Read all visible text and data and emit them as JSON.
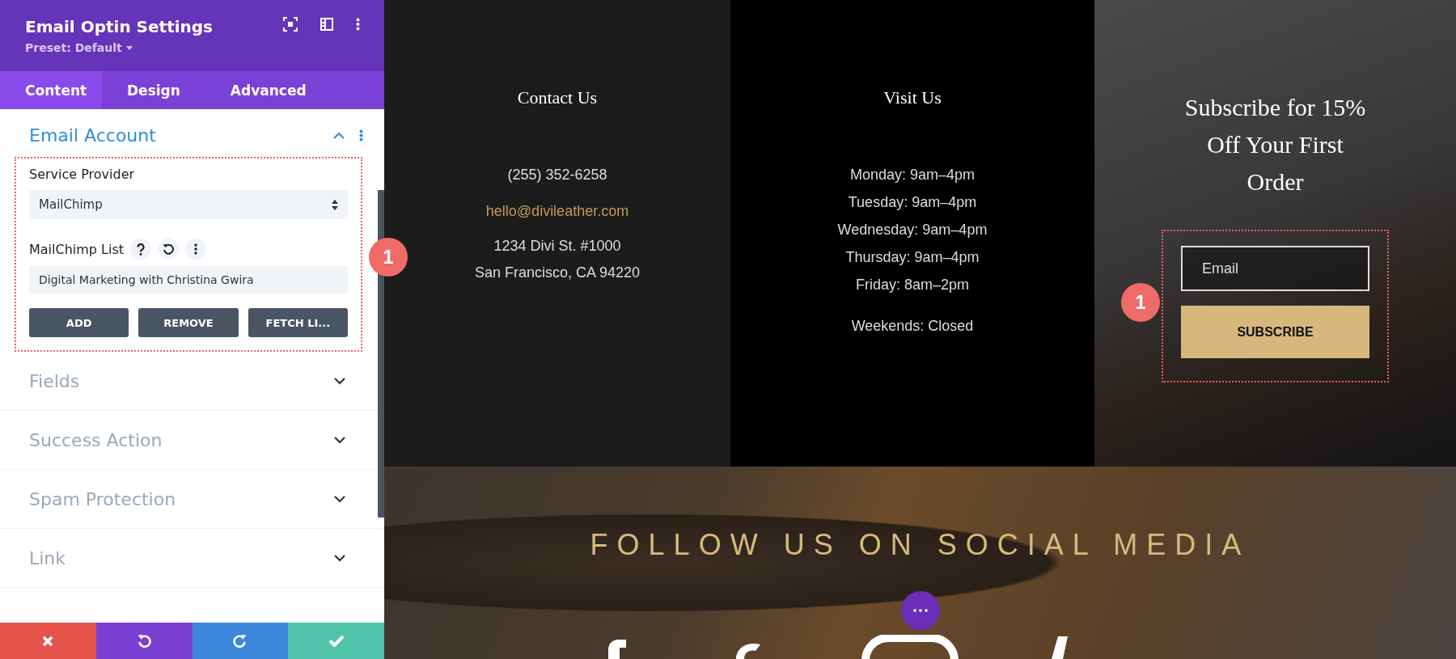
{
  "panel": {
    "title": "Email Optin Settings",
    "preset": "Preset: Default",
    "tabs": [
      {
        "label": "Content",
        "selected": true
      },
      {
        "label": "Design",
        "selected": false
      },
      {
        "label": "Advanced",
        "selected": false
      }
    ],
    "account": {
      "title": "Email Account",
      "expanded": true,
      "provider_label": "Service Provider",
      "provider_value": "MailChimp",
      "list_label": "MailChimp List",
      "list_value": "Digital Marketing with Christina Gwira",
      "buttons": [
        "ADD",
        "REMOVE",
        "FETCH LI..."
      ]
    },
    "sections": [
      {
        "title": "Fields",
        "expanded": false
      },
      {
        "title": "Success Action",
        "expanded": false
      },
      {
        "title": "Spam Protection",
        "expanded": false
      },
      {
        "title": "Link",
        "expanded": false
      }
    ],
    "footer": [
      {
        "kind": "cancel"
      },
      {
        "kind": "undo"
      },
      {
        "kind": "redo"
      },
      {
        "kind": "save"
      }
    ]
  },
  "page": {
    "contact": {
      "heading": "Contact Us",
      "phone": "(255) 352-6258",
      "email": "hello@divileather.com",
      "address": [
        "1234 Divi St. #1000",
        "San Francisco, CA 94220"
      ]
    },
    "visit": {
      "heading": "Visit Us",
      "hours": [
        "Monday: 9am–4pm",
        "Tuesday: 9am–4pm",
        "Wednesday: 9am–4pm",
        "Thursday: 9am–4pm",
        "Friday: 8am–2pm"
      ],
      "weekend": "Weekends: Closed"
    },
    "subscribe": {
      "heading": "Subscribe for 15% Off Your First Order",
      "placeholder": "Email",
      "button": "SUBSCRIBE"
    },
    "social": {
      "heading": "FOLLOW US ON SOCIAL MEDIA"
    }
  },
  "markers": [
    "1",
    "1"
  ]
}
